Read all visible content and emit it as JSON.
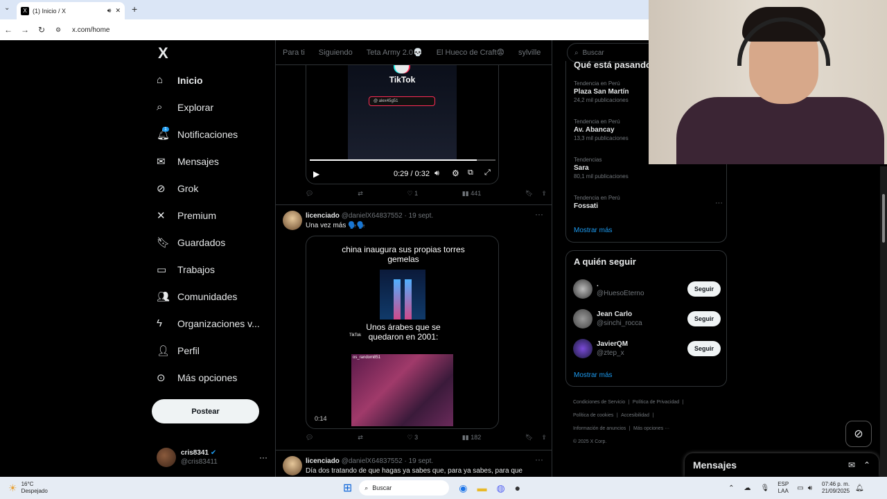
{
  "browser": {
    "tab_title": "(1) Inicio / X",
    "url": "x.com/home",
    "new_tab": "+"
  },
  "sidebar": {
    "logo": "X",
    "items": [
      {
        "label": "Inicio",
        "icon": "home-icon",
        "glyph": "⌂"
      },
      {
        "label": "Explorar",
        "icon": "search-icon",
        "glyph": "⌕"
      },
      {
        "label": "Notificaciones",
        "icon": "bell-icon",
        "glyph": "🔔︎",
        "badge": "1"
      },
      {
        "label": "Mensajes",
        "icon": "envelope-icon",
        "glyph": "✉"
      },
      {
        "label": "Grok",
        "icon": "grok-icon",
        "glyph": "⊘"
      },
      {
        "label": "Premium",
        "icon": "x-premium-icon",
        "glyph": "✕"
      },
      {
        "label": "Guardados",
        "icon": "bookmark-icon",
        "glyph": "🔖︎"
      },
      {
        "label": "Trabajos",
        "icon": "briefcase-icon",
        "glyph": "▭"
      },
      {
        "label": "Comunidades",
        "icon": "people-icon",
        "glyph": "👥︎"
      },
      {
        "label": "Organizaciones v...",
        "icon": "bolt-icon",
        "glyph": "ϟ"
      },
      {
        "label": "Perfil",
        "icon": "person-icon",
        "glyph": "👤︎"
      },
      {
        "label": "Más opciones",
        "icon": "more-circle-icon",
        "glyph": "⊙"
      }
    ],
    "post_label": "Postear",
    "account": {
      "name": "cris8341",
      "handle": "@cris83411",
      "more": "···"
    }
  },
  "feed": {
    "tabs": [
      "Para ti",
      "Siguiendo",
      "Teta Army 2.0💀",
      "El Hueco de Craft😨",
      "sylville"
    ],
    "video1": {
      "tiktok_label": "TikTok",
      "tiktok_user": "@ alex45g51",
      "time": "0:29 / 0:32",
      "progress": 0.9,
      "actions": {
        "replies": "",
        "reposts": "",
        "likes": "1",
        "views": "441"
      }
    },
    "tweet2": {
      "name": "licenciado",
      "handle": "@danielX64837552",
      "date": "· 19 sept.",
      "text": "Una vez más 🗣️🗣️",
      "caption_top": "china inaugura sus propias torres gemelas",
      "caption_mid": "Unos árabes que se quedaron en 2001:",
      "tiktok_mini": "TikTok",
      "watermark": "os_random851",
      "duration": "0:14",
      "actions": {
        "replies": "",
        "reposts": "",
        "likes": "3",
        "views": "182"
      }
    },
    "tweet3": {
      "name": "licenciado",
      "handle": "@danielX64837552",
      "date": "· 19 sept.",
      "text": "Día dos tratando de que hagas ya sabes que, para ya sabes, para que"
    }
  },
  "right": {
    "search_placeholder": "Buscar",
    "trends_title": "Qué está pasando",
    "trends": [
      {
        "category": "Tendencia en Perú",
        "name": "Plaza San Martín",
        "count": "24,2 mil publicaciones"
      },
      {
        "category": "Tendencia en Perú",
        "name": "Av. Abancay",
        "count": "13,3 mil publicaciones"
      },
      {
        "category": "Tendencias",
        "name": "Sara",
        "count": "80,1 mil publicaciones"
      },
      {
        "category": "Tendencia en Perú",
        "name": "Fossati",
        "count": ""
      }
    ],
    "show_more": "Mostrar más",
    "follow_title": "A quién seguir",
    "follow": [
      {
        "name": ".",
        "handle": "@HuesoEterno",
        "button": "Seguir"
      },
      {
        "name": "Jean Carlo",
        "handle": "@sinchi_rocca",
        "button": "Seguir"
      },
      {
        "name": "JavierQM",
        "handle": "@ztep_x",
        "button": "Seguir"
      }
    ],
    "footer": [
      "Condiciones de Servicio",
      "Política de Privacidad",
      "Política de cookies",
      "Accesibilidad",
      "Información de anuncios",
      "Más opciones ···",
      "© 2025 X Corp."
    ],
    "messages_label": "Mensajes"
  },
  "taskbar": {
    "weather_temp": "16°C",
    "weather_desc": "Despejado",
    "search": "Buscar",
    "lang_top": "ESP",
    "lang_bottom": "LAA",
    "time": "07:46 p. m.",
    "date": "21/09/2025"
  }
}
